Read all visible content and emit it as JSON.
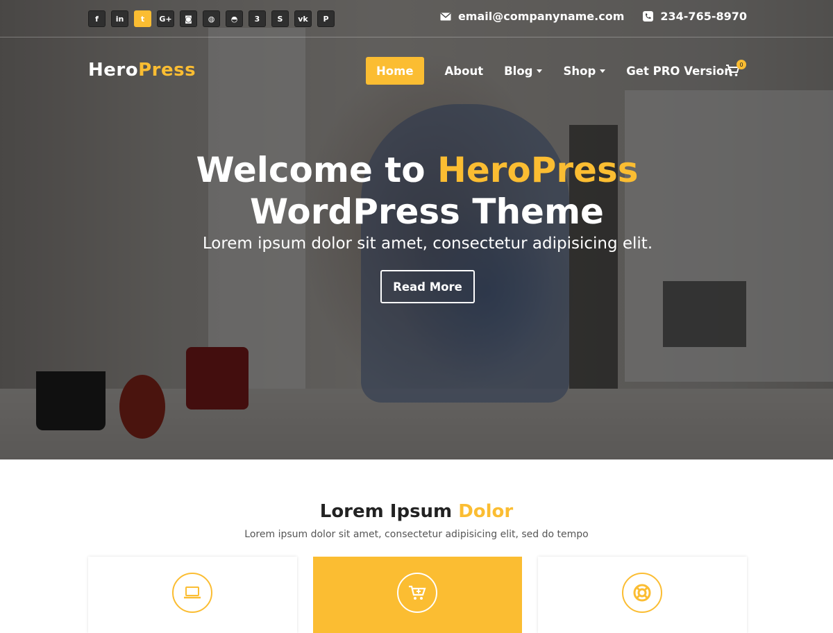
{
  "topbar": {
    "social": [
      {
        "icon": "facebook-icon",
        "glyph": "f"
      },
      {
        "icon": "linkedin-icon",
        "glyph": "in"
      },
      {
        "icon": "twitter-icon",
        "glyph": "t"
      },
      {
        "icon": "google-plus-icon",
        "glyph": "G+"
      },
      {
        "icon": "instagram-icon",
        "glyph": "◙"
      },
      {
        "icon": "dribbble-icon",
        "glyph": "◍"
      },
      {
        "icon": "github-icon",
        "glyph": "◓"
      },
      {
        "icon": "css3-icon",
        "glyph": "3"
      },
      {
        "icon": "skype-icon",
        "glyph": "S"
      },
      {
        "icon": "vk-icon",
        "glyph": "vk"
      },
      {
        "icon": "pinterest-icon",
        "glyph": "P"
      }
    ],
    "email": "email@companyname.com",
    "phone": "234-765-8970"
  },
  "logo": {
    "part1": "Hero",
    "part2": "Press"
  },
  "nav": {
    "home": "Home",
    "about": "About",
    "blog": "Blog",
    "shop": "Shop",
    "pro": "Get PRO Version",
    "cart_count": "0"
  },
  "hero": {
    "title_prefix": "Welcome to ",
    "title_highlight": "HeroPress",
    "title_line2": "WordPress Theme",
    "subtitle": "Lorem ipsum dolor sit amet, consectetur adipisicing elit.",
    "button": "Read More"
  },
  "section": {
    "title_main": "Lorem Ipsum ",
    "title_highlight": "Dolor",
    "subtitle": "Lorem ipsum dolor sit amet, consectetur adipisicing elit, sed do tempo"
  },
  "cards": [
    {
      "icon": "laptop-icon"
    },
    {
      "icon": "cart-plus-icon"
    },
    {
      "icon": "life-ring-icon"
    }
  ],
  "colors": {
    "accent": "#fbbd32",
    "overlay": "rgba(0,0,0,0.52)",
    "text_dark": "#222222"
  }
}
